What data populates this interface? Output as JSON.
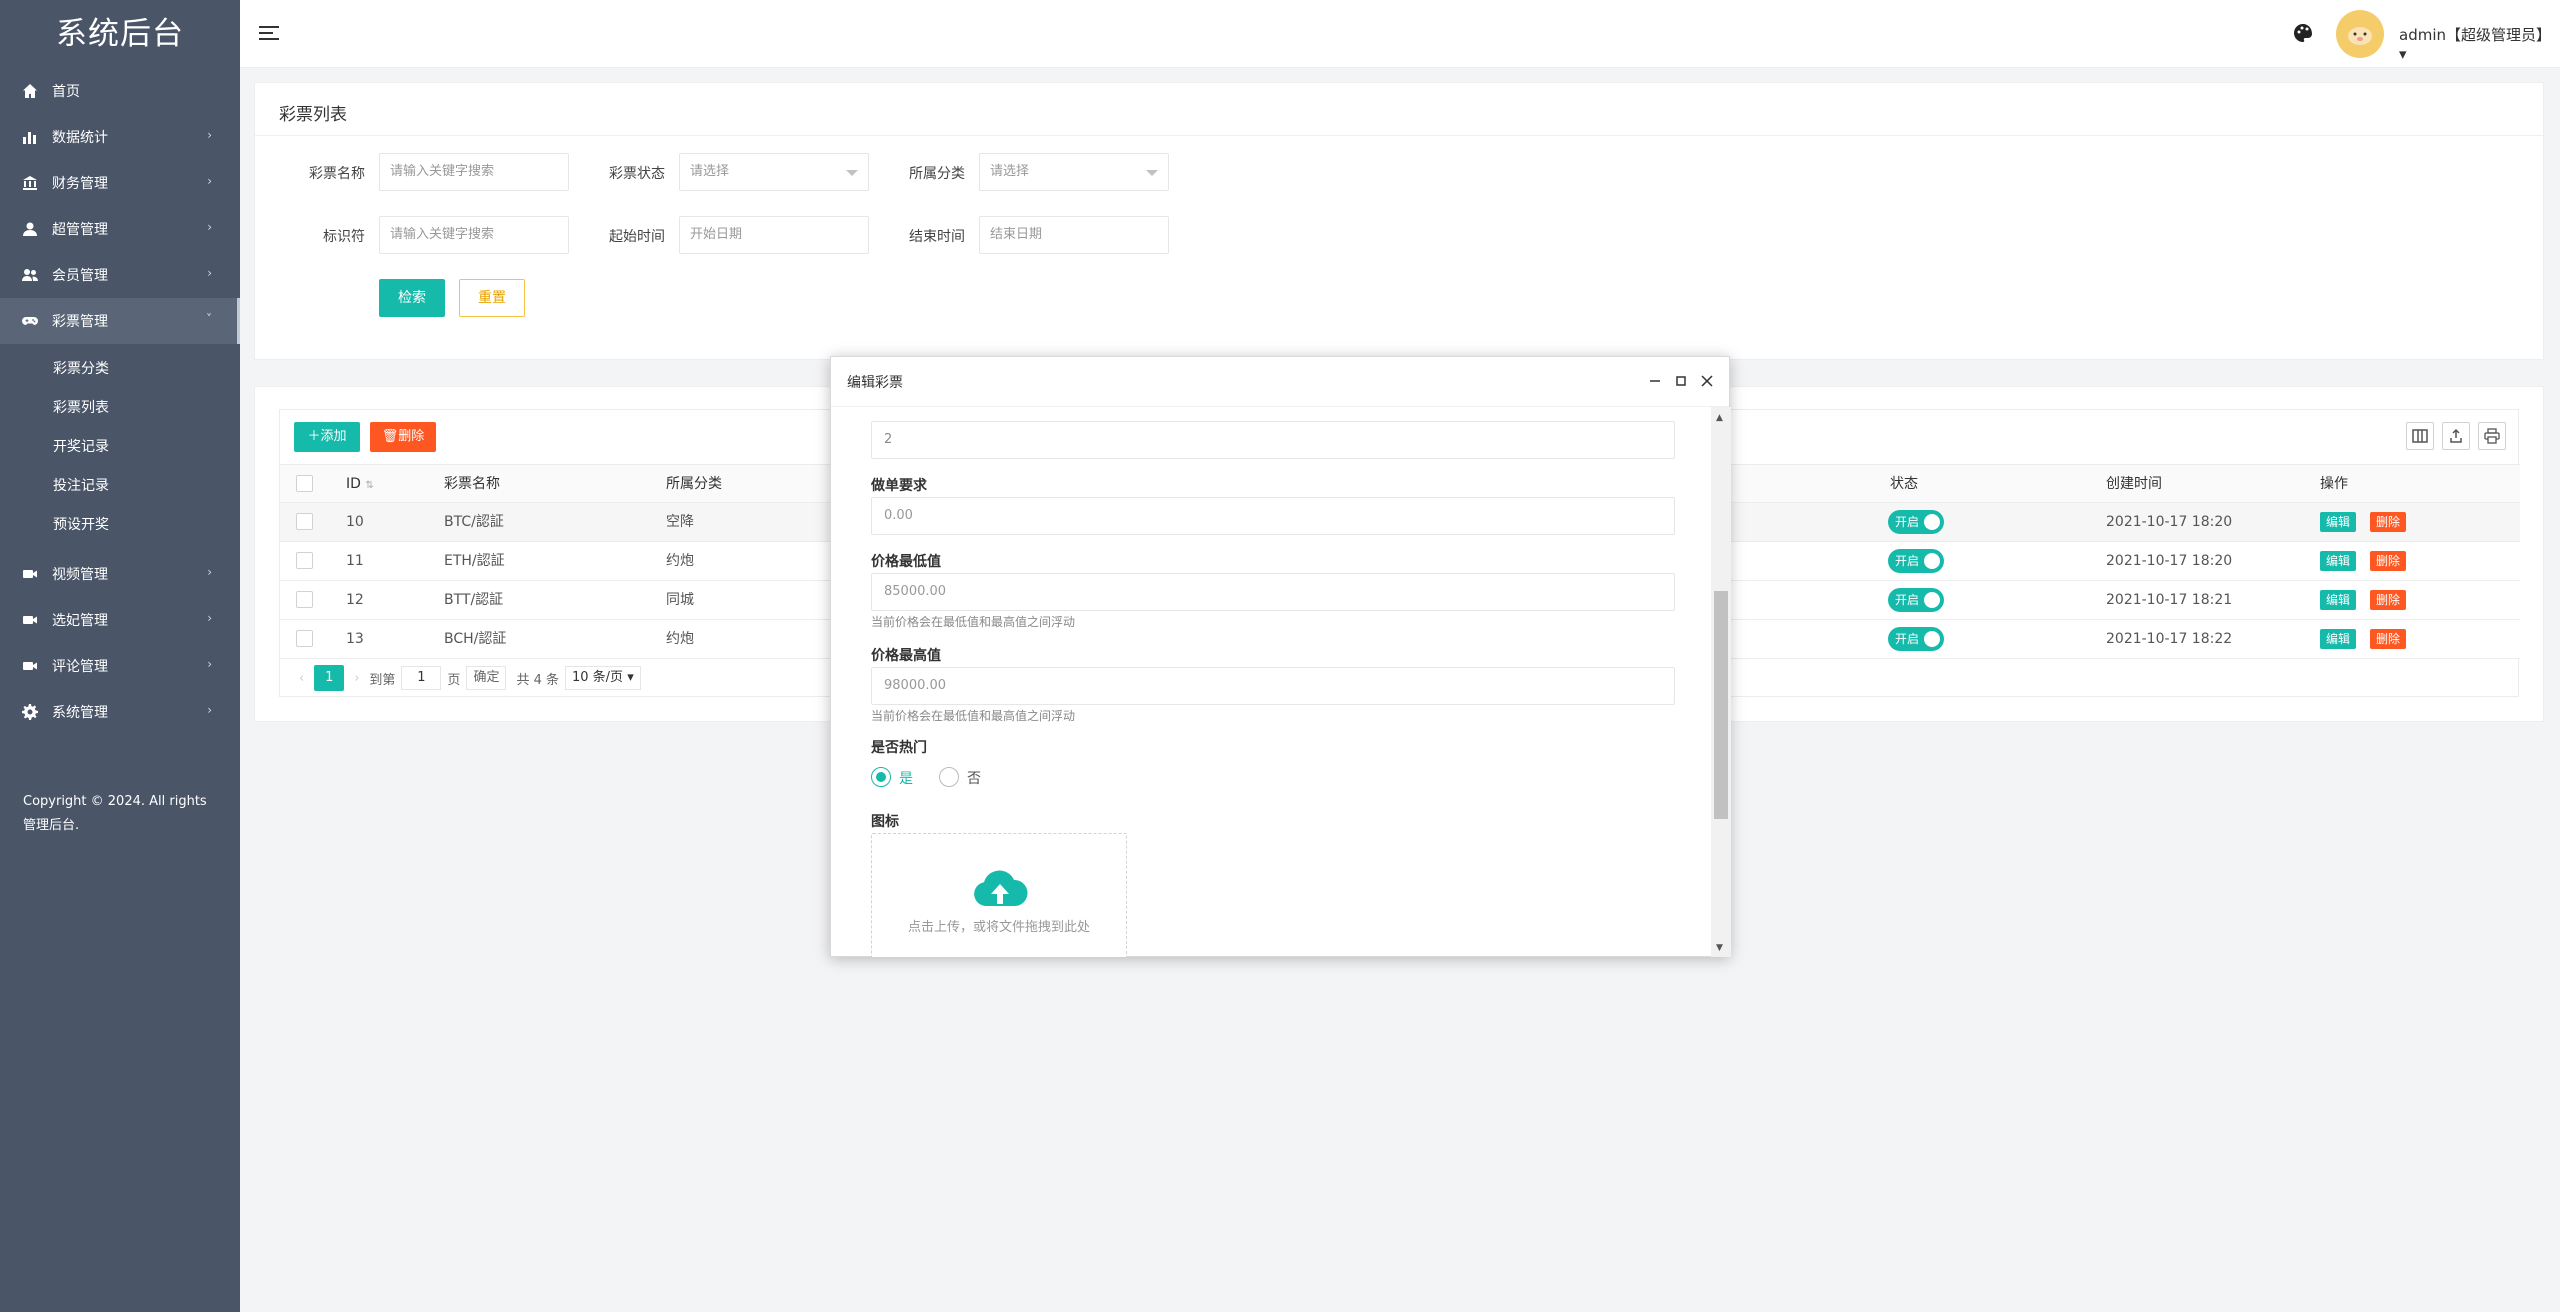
{
  "brand": {
    "title": "系统后台"
  },
  "sidebar": {
    "items": [
      {
        "label": "首页",
        "icon": "home-icon"
      },
      {
        "label": "数据统计",
        "icon": "bar-chart-icon"
      },
      {
        "label": "财务管理",
        "icon": "bank-icon"
      },
      {
        "label": "超管管理",
        "icon": "user-icon"
      },
      {
        "label": "会员管理",
        "icon": "users-icon"
      },
      {
        "label": "彩票管理",
        "icon": "gamepad-icon"
      }
    ],
    "sub_items": [
      "彩票分类",
      "彩票列表",
      "开奖记录",
      "投注记录",
      "预设开奖"
    ],
    "items_after": [
      {
        "label": "视频管理",
        "icon": "video-icon"
      },
      {
        "label": "选妃管理",
        "icon": "video-icon"
      },
      {
        "label": "评论管理",
        "icon": "video-icon"
      },
      {
        "label": "系统管理",
        "icon": "gear-icon"
      }
    ],
    "copyright": "Copyright © 2024. All rights 管理后台."
  },
  "header": {
    "user": "admin【超级管理员】"
  },
  "search": {
    "title": "彩票列表",
    "fields": {
      "name_label": "彩票名称",
      "name_placeholder": "请输入关键字搜索",
      "status_label": "彩票状态",
      "status_placeholder": "请选择",
      "category_label": "所属分类",
      "category_placeholder": "请选择",
      "key_label": "标识符",
      "key_placeholder": "请输入关键字搜索",
      "start_label": "起始时间",
      "start_placeholder": "开始日期",
      "end_label": "结束时间",
      "end_placeholder": "结束日期"
    },
    "search_btn": "检索",
    "reset_btn": "重置"
  },
  "table": {
    "add_btn": "添加",
    "delete_btn": "删除",
    "columns": [
      "ID",
      "彩票名称",
      "所属分类",
      "状态",
      "创建时间",
      "操作"
    ],
    "rows": [
      {
        "id": "10",
        "name": "BTC/認証",
        "category": "空降",
        "status": "开启",
        "created": "2021-10-17 18:20"
      },
      {
        "id": "11",
        "name": "ETH/認証",
        "category": "约炮",
        "status": "开启",
        "created": "2021-10-17 18:20"
      },
      {
        "id": "12",
        "name": "BTT/認証",
        "category": "同城",
        "status": "开启",
        "created": "2021-10-17 18:21"
      },
      {
        "id": "13",
        "name": "BCH/認証",
        "category": "约炮",
        "status": "开启",
        "created": "2021-10-17 18:22"
      }
    ],
    "edit_label": "编辑",
    "del_label": "删除",
    "pager": {
      "current": "1",
      "goto": "到第",
      "page_input": "1",
      "page_unit": "页",
      "confirm": "确定",
      "total": "共 4 条",
      "per_page": "10 条/页"
    }
  },
  "modal": {
    "title": "编辑彩票",
    "top_value": "2",
    "fields": [
      {
        "label": "做单要求",
        "value": "0.00"
      },
      {
        "label": "价格最低值",
        "value": "85000.00",
        "hint": "当前价格会在最低值和最高值之间浮动"
      },
      {
        "label": "价格最高值",
        "value": "98000.00",
        "hint": "当前价格会在最低值和最高值之间浮动"
      }
    ],
    "hot_label": "是否热门",
    "hot_yes": "是",
    "hot_no": "否",
    "icon_label": "图标",
    "upload_text": "点击上传，或将文件拖拽到此处"
  }
}
